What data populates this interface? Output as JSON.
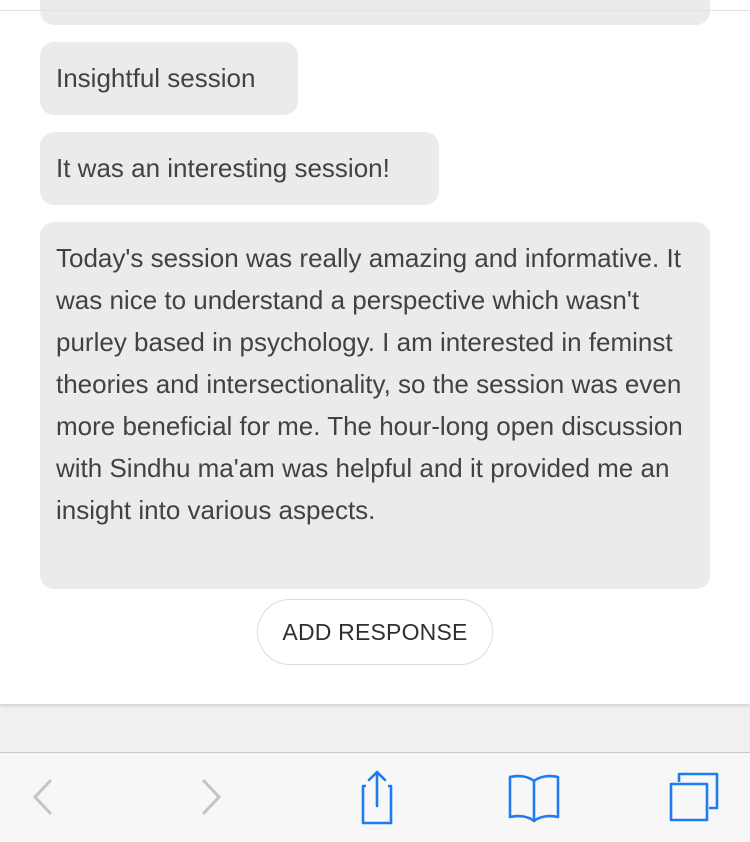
{
  "comments": [
    {
      "text": "Insightful session"
    },
    {
      "text": "It was an interesting session!"
    },
    {
      "text": "Today's session was really amazing and informative. It was nice to understand a perspective which wasn't purley based in psychology. I am interested in feminst theories and intersectionality, so the session was even more beneficial for me. The hour-long open discussion with Sindhu ma'am was helpful and it provided me an insight into various aspects."
    }
  ],
  "add_response_label": "ADD RESPONSE",
  "toolbar": {
    "icons": [
      "back-icon",
      "forward-icon",
      "share-icon",
      "bookmarks-icon",
      "tabs-icon"
    ],
    "active_color": "#1f7bf2",
    "disabled_color": "#c4c4c7"
  }
}
